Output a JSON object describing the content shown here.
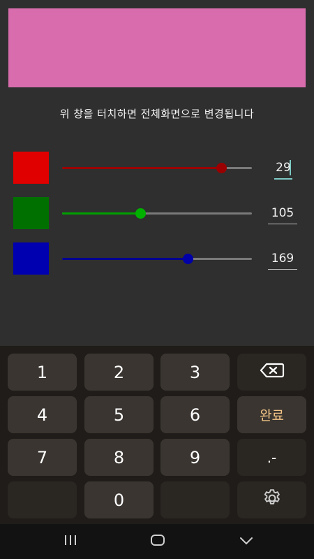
{
  "preview": {
    "color": "#d86cac"
  },
  "hint_text": "위 창을 터치하면 전체화면으로 변경됩니다",
  "sliders": [
    {
      "channel": "red",
      "swatch_color": "#e00000",
      "accent": "#9b0000",
      "value": "29",
      "fraction": 0.84,
      "editing": true
    },
    {
      "channel": "green",
      "swatch_color": "#007000",
      "accent": "#00a000",
      "value": "105",
      "fraction": 0.41
    },
    {
      "channel": "blue",
      "swatch_color": "#0000b0",
      "accent": "#000090",
      "value": "169",
      "fraction": 0.66
    }
  ],
  "keyboard": {
    "keys": [
      "1",
      "2",
      "3",
      "4",
      "5",
      "6",
      "7",
      "8",
      "9",
      "0"
    ],
    "done_label": "완료",
    "punct_label": ".-",
    "backspace_icon": "backspace-icon",
    "settings_icon": "gear-icon"
  },
  "navbar": {
    "recent_icon": "recent-apps-icon",
    "home_icon": "home-icon",
    "back_icon": "back-chevron-icon"
  }
}
